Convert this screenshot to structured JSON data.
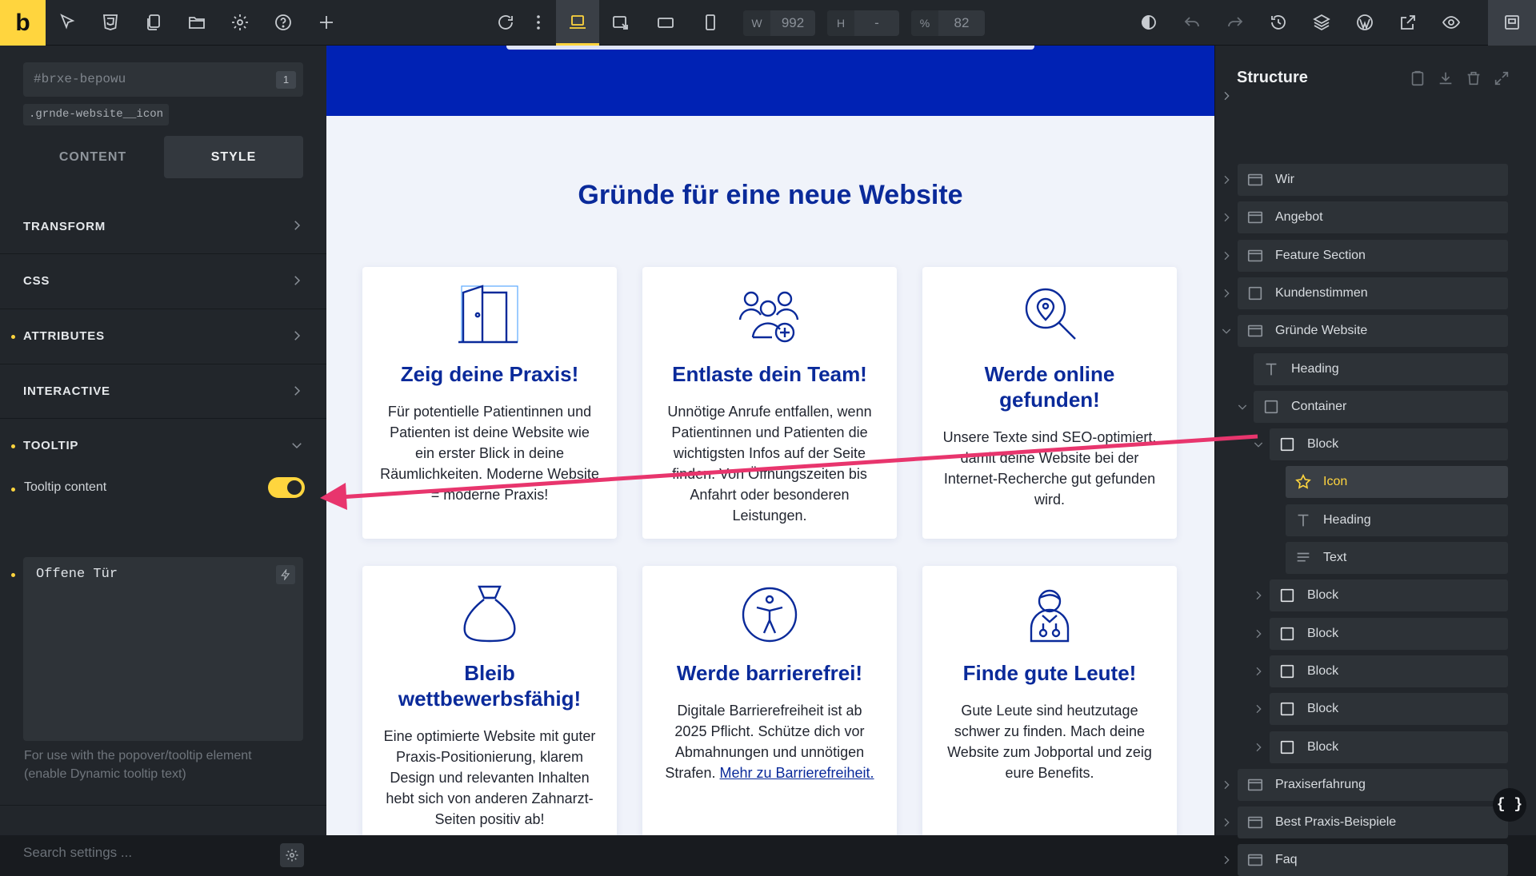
{
  "app": {
    "logo_letter": "b"
  },
  "toolbar": {
    "width_label": "W",
    "width_value": "992",
    "height_label": "H",
    "height_value": "-",
    "scale_label": "%",
    "scale_value": "82"
  },
  "left_panel": {
    "selector_id": "#brxe-bepowu",
    "selector_count": "1",
    "class_chip": ".grnde-website__icon",
    "tabs": [
      {
        "label": "CONTENT"
      },
      {
        "label": "STYLE"
      }
    ],
    "sections": [
      {
        "label": "TRANSFORM"
      },
      {
        "label": "CSS"
      },
      {
        "label": "ATTRIBUTES"
      },
      {
        "label": "INTERACTIVE"
      },
      {
        "label": "TOOLTIP"
      }
    ],
    "tooltip": {
      "content_label": "Tooltip content",
      "toggle_on": true,
      "text_value": "Offene Tür",
      "help_line1": "For use with the popover/tooltip element",
      "help_line2": "(enable Dynamic tooltip text)"
    },
    "search_placeholder": "Search settings ..."
  },
  "canvas": {
    "section_title": "Gründe für eine neue Website",
    "cards": [
      {
        "icon": "door-icon",
        "title": "Zeig deine Praxis!",
        "text": "Für potentielle Patientinnen und Patienten ist deine Website wie ein erster Blick in deine Räumlichkeiten. Moderne Website = moderne Praxis!"
      },
      {
        "icon": "team-add-icon",
        "title": "Entlaste dein Team!",
        "text": "Unnötige Anrufe entfallen, wenn Patientinnen und Patienten die wichtigsten Infos auf der Seite finden. Von Öffnungszeiten bis Anfahrt oder besonderen Leistungen."
      },
      {
        "icon": "search-location-icon",
        "title": "Werde online gefunden!",
        "text": "Unsere Texte sind SEO-optimiert, damit deine Website bei der Internet-Recherche gut gefunden wird."
      },
      {
        "icon": "money-bag-icon",
        "title": "Bleib wettbewerbsfähig!",
        "text": "Eine optimierte Website mit guter Praxis-Positionierung, klarem Design und relevanten Inhalten hebt sich von anderen Zahnarzt-Seiten positiv ab!"
      },
      {
        "icon": "accessibility-icon",
        "title": "Werde barrierefrei!",
        "text": "Digitale Barrierefreiheit ist ab 2025 Pflicht. Schütze dich vor Abmahnungen und unnötigen Strafen.",
        "link": "Mehr zu Barrierefreiheit."
      },
      {
        "icon": "people-icon",
        "title": "Finde gute Leute!",
        "text": "Gute Leute sind heutzutage schwer zu finden. Mach deine Website zum Jobportal und zeig eure Benefits."
      }
    ]
  },
  "structure": {
    "title": "Structure",
    "items": [
      {
        "label": "Wir",
        "icon": "section-icon"
      },
      {
        "label": "Angebot",
        "icon": "section-icon"
      },
      {
        "label": "Feature Section",
        "icon": "section-icon"
      },
      {
        "label": "Kundenstimmen",
        "icon": "container-icon"
      },
      {
        "label": "Gründe Website",
        "icon": "section-icon"
      },
      {
        "label": "Heading",
        "icon": "heading-icon"
      },
      {
        "label": "Container",
        "icon": "container-icon"
      },
      {
        "label": "Block",
        "icon": "block-icon"
      },
      {
        "label": "Icon",
        "icon": "star-icon"
      },
      {
        "label": "Heading",
        "icon": "heading-icon"
      },
      {
        "label": "Text",
        "icon": "text-icon"
      },
      {
        "label": "Block",
        "icon": "block-icon"
      },
      {
        "label": "Block",
        "icon": "block-icon"
      },
      {
        "label": "Block",
        "icon": "block-icon"
      },
      {
        "label": "Block",
        "icon": "block-icon"
      },
      {
        "label": "Block",
        "icon": "block-icon"
      },
      {
        "label": "Praxiserfahrung",
        "icon": "section-icon"
      },
      {
        "label": "Best Praxis-Beispiele",
        "icon": "section-icon"
      },
      {
        "label": "Faq",
        "icon": "section-icon"
      }
    ],
    "code_button": "{ }"
  },
  "colors": {
    "accent": "#ffd53e",
    "brand_blue": "#0a2a9a",
    "annotation": "#e8356d"
  }
}
